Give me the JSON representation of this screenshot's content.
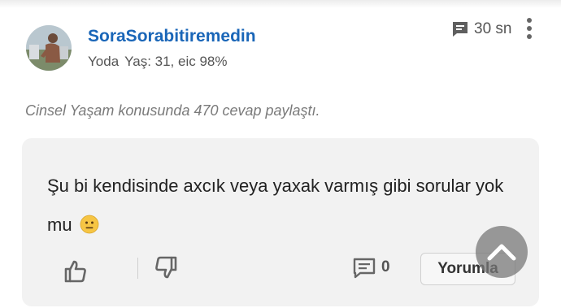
{
  "user": {
    "name": "SoraSorabitiremedin",
    "rank": "Yoda",
    "stats": "Yaş: 31, eic 98%"
  },
  "post_meta": {
    "time": "30 sn",
    "icon": "message-icon"
  },
  "activity": "Cinsel Yaşam konusunda 470 cevap paylaştı.",
  "answer": {
    "text": "Şu bi kendisinde axcık veya yaxak varmış gibi sorular yok mu",
    "emoji": "neutral-face-emoji"
  },
  "actions": {
    "like_icon": "thumbs-up-icon",
    "dislike_icon": "thumbs-down-icon",
    "comment_count": "0",
    "reply_label": "Yorumla"
  },
  "colors": {
    "username": "#1a66b8",
    "card_background": "#f2f2f2",
    "emoji_yellow": "#f6c544"
  }
}
